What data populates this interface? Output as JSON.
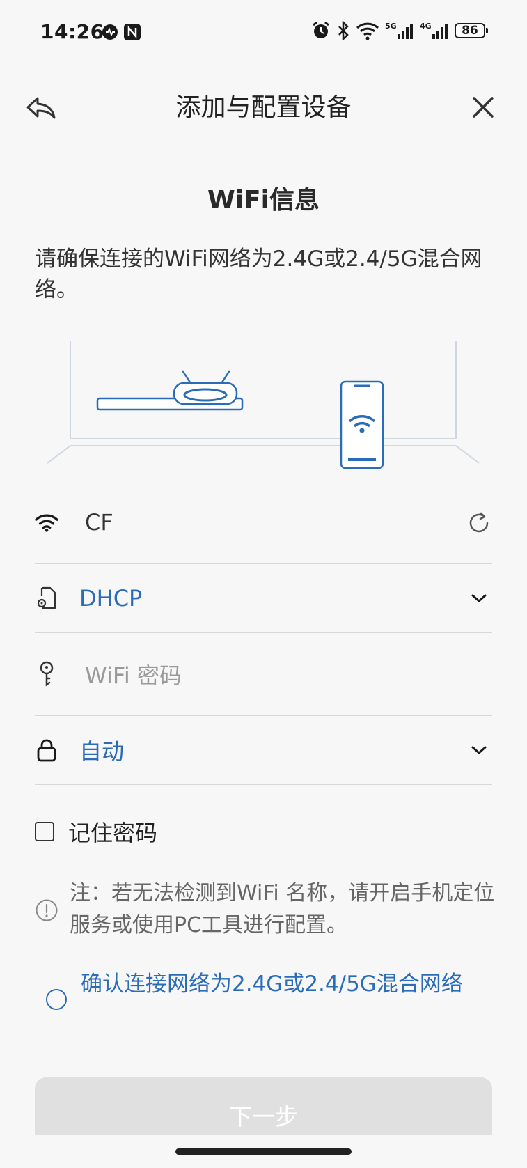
{
  "status_bar": {
    "time": "14:26",
    "battery": "86"
  },
  "header": {
    "title": "添加与配置设备"
  },
  "section_title": "WiFi信息",
  "intro": "请确保连接的WiFi网络为2.4G或2.4/5G混合网络。",
  "form": {
    "ssid": "CF",
    "ip_mode": "DHCP",
    "password_placeholder": "WiFi 密码",
    "security": "自动"
  },
  "remember_password_label": "记住密码",
  "note": "注：若无法检测到WiFi 名称，请开启手机定位服务或使用PC工具进行配置。",
  "confirm_label": "确认连接网络为2.4G或2.4/5G混合网络",
  "next_button_label": "下一步",
  "colors": {
    "accent": "#2b6cb8",
    "disabled_button": "#e0e0e0"
  }
}
